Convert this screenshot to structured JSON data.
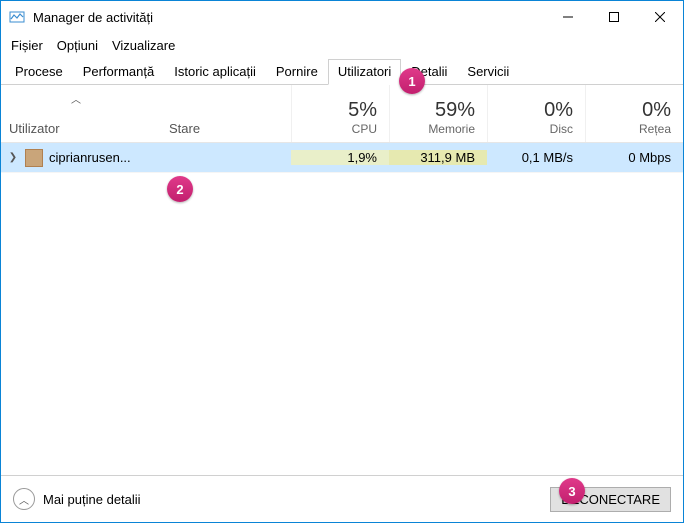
{
  "window": {
    "title": "Manager de activități"
  },
  "menu": {
    "file": "Fișier",
    "options": "Opțiuni",
    "view": "Vizualizare"
  },
  "tabs": {
    "processes": "Procese",
    "performance": "Performanță",
    "history": "Istoric aplicații",
    "startup": "Pornire",
    "users": "Utilizatori",
    "details": "Detalii",
    "services": "Servicii"
  },
  "columns": {
    "user": "Utilizator",
    "status": "Stare",
    "cpu_val": "5%",
    "cpu_lab": "CPU",
    "mem_val": "59%",
    "mem_lab": "Memorie",
    "disk_val": "0%",
    "disk_lab": "Disc",
    "net_val": "0%",
    "net_lab": "Rețea"
  },
  "row": {
    "name": "ciprianrusen...",
    "status": "",
    "cpu": "1,9%",
    "mem": "311,9 MB",
    "disk": "0,1 MB/s",
    "net": "0 Mbps"
  },
  "footer": {
    "fewer": "Mai puține detalii",
    "disconnect": "DECONECTARE"
  },
  "badges": {
    "b1": "1",
    "b2": "2",
    "b3": "3"
  }
}
